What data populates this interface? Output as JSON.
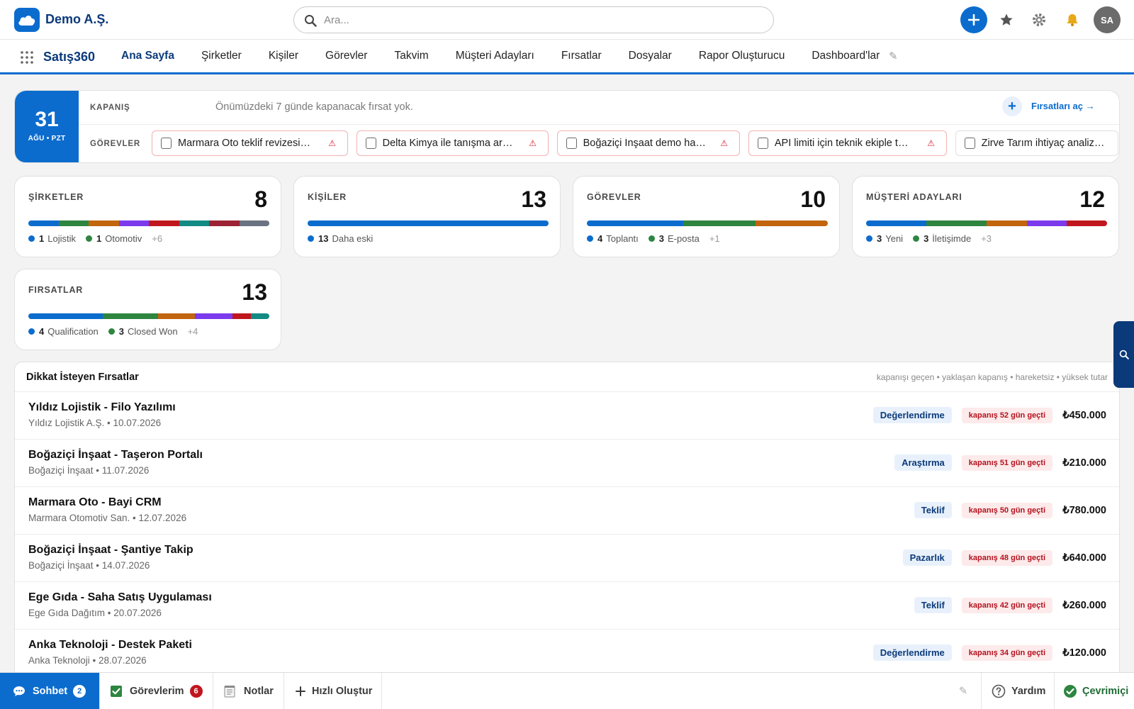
{
  "header": {
    "org_name": "Demo A.Ş.",
    "search_placeholder": "Ara...",
    "avatar_initials": "SA"
  },
  "nav": {
    "app_name": "Satış360",
    "tabs": [
      {
        "label": "Ana Sayfa",
        "active": true
      },
      {
        "label": "Şirketler"
      },
      {
        "label": "Kişiler"
      },
      {
        "label": "Görevler"
      },
      {
        "label": "Takvim"
      },
      {
        "label": "Müşteri Adayları"
      },
      {
        "label": "Fırsatlar"
      },
      {
        "label": "Dosyalar"
      },
      {
        "label": "Rapor Oluşturucu"
      },
      {
        "label": "Dashboard'lar"
      }
    ]
  },
  "today": {
    "day": "31",
    "label": "AĞU • PZT",
    "closing_label": "KAPANIŞ",
    "closing_text": "Önümüzdeki 7 günde kapanacak fırsat yok.",
    "open_link": "Fırsatları aç →",
    "tasks_label": "GÖREVLER",
    "tasks": [
      {
        "text": "Marmara Oto teklif revizesini g...",
        "overdue": true
      },
      {
        "text": "Delta Kimya ile tanışma araması",
        "overdue": true
      },
      {
        "text": "Boğaziçi İnşaat demo hazırlığı",
        "overdue": true
      },
      {
        "text": "API limiti için teknik ekiple topla...",
        "overdue": true
      },
      {
        "text": "Zirve Tarım ihtiyaç analizi e-po",
        "overdue": false
      }
    ]
  },
  "cards": [
    {
      "title": "ŞİRKETLER",
      "count": "8",
      "segments": [
        {
          "color": "#0b6cce",
          "value": 1
        },
        {
          "color": "#2e8540",
          "value": 1
        },
        {
          "color": "#c2650f",
          "value": 1
        },
        {
          "color": "#7c3aed",
          "value": 1
        },
        {
          "color": "#c0171f",
          "value": 1
        },
        {
          "color": "#138a84",
          "value": 1
        },
        {
          "color": "#9b2335",
          "value": 1
        },
        {
          "color": "#6b7280",
          "value": 1
        }
      ],
      "legend": [
        {
          "num": "1",
          "label": "Lojistik",
          "color": "#0b6cce"
        },
        {
          "num": "1",
          "label": "Otomotiv",
          "color": "#2e8540"
        }
      ],
      "more": "+6"
    },
    {
      "title": "KİŞİLER",
      "count": "13",
      "segments": [
        {
          "color": "#0b6cce",
          "value": 13
        }
      ],
      "legend": [
        {
          "num": "13",
          "label": "Daha eski",
          "color": "#0b6cce"
        }
      ],
      "more": ""
    },
    {
      "title": "GÖREVLER",
      "count": "10",
      "segments": [
        {
          "color": "#0b6cce",
          "value": 4
        },
        {
          "color": "#2e8540",
          "value": 3
        },
        {
          "color": "#c2650f",
          "value": 3
        }
      ],
      "legend": [
        {
          "num": "4",
          "label": "Toplantı",
          "color": "#0b6cce"
        },
        {
          "num": "3",
          "label": "E-posta",
          "color": "#2e8540"
        }
      ],
      "more": "+1"
    },
    {
      "title": "MÜŞTERİ ADAYLARI",
      "count": "12",
      "segments": [
        {
          "color": "#0b6cce",
          "value": 3
        },
        {
          "color": "#2e8540",
          "value": 3
        },
        {
          "color": "#c2650f",
          "value": 2
        },
        {
          "color": "#7c3aed",
          "value": 2
        },
        {
          "color": "#c0171f",
          "value": 2
        }
      ],
      "legend": [
        {
          "num": "3",
          "label": "Yeni",
          "color": "#0b6cce"
        },
        {
          "num": "3",
          "label": "İletişimde",
          "color": "#2e8540"
        }
      ],
      "more": "+3"
    },
    {
      "title": "FIRSATLAR",
      "count": "13",
      "segments": [
        {
          "color": "#0b6cce",
          "value": 4
        },
        {
          "color": "#2e8540",
          "value": 3
        },
        {
          "color": "#c2650f",
          "value": 2
        },
        {
          "color": "#7c3aed",
          "value": 2
        },
        {
          "color": "#c0171f",
          "value": 1
        },
        {
          "color": "#138a84",
          "value": 1
        }
      ],
      "legend": [
        {
          "num": "4",
          "label": "Qualification",
          "color": "#0b6cce"
        },
        {
          "num": "3",
          "label": "Closed Won",
          "color": "#2e8540"
        }
      ],
      "more": "+4"
    }
  ],
  "attention": {
    "title": "Dikkat İsteyen Fırsatlar",
    "hint": "kapanışı geçen • yaklaşan kapanış • hareketsiz • yüksek tutar",
    "rows": [
      {
        "name": "Yıldız Lojistik - Filo Yazılımı",
        "sub": "Yıldız Lojistik A.Ş. • 10.07.2026",
        "stage": "Değerlendirme",
        "overdue": "kapanış 52 gün geçti",
        "amount": "₺450.000"
      },
      {
        "name": "Boğaziçi İnşaat - Taşeron Portalı",
        "sub": "Boğaziçi İnşaat • 11.07.2026",
        "stage": "Araştırma",
        "overdue": "kapanış 51 gün geçti",
        "amount": "₺210.000"
      },
      {
        "name": "Marmara Oto - Bayi CRM",
        "sub": "Marmara Otomotiv San. • 12.07.2026",
        "stage": "Teklif",
        "overdue": "kapanış 50 gün geçti",
        "amount": "₺780.000"
      },
      {
        "name": "Boğaziçi İnşaat - Şantiye Takip",
        "sub": "Boğaziçi İnşaat • 14.07.2026",
        "stage": "Pazarlık",
        "overdue": "kapanış 48 gün geçti",
        "amount": "₺640.000"
      },
      {
        "name": "Ege Gıda - Saha Satış Uygulaması",
        "sub": "Ege Gıda Dağıtım • 20.07.2026",
        "stage": "Teklif",
        "overdue": "kapanış 42 gün geçti",
        "amount": "₺260.000"
      },
      {
        "name": "Anka Teknoloji - Destek Paketi",
        "sub": "Anka Teknoloji • 28.07.2026",
        "stage": "Değerlendirme",
        "overdue": "kapanış 34 gün geçti",
        "amount": "₺120.000"
      }
    ]
  },
  "bottom": {
    "chat": "Sohbet",
    "chat_badge": "2",
    "tasks": "Görevlerim",
    "tasks_badge": "6",
    "notes": "Notlar",
    "quick_create": "Hızlı Oluştur",
    "help": "Yardım",
    "status": "Çevrimiçi"
  },
  "colors": {
    "accent": "#0b6cce",
    "navy": "#0b3a7a",
    "danger": "#c0171f",
    "online": "#2e8540"
  }
}
